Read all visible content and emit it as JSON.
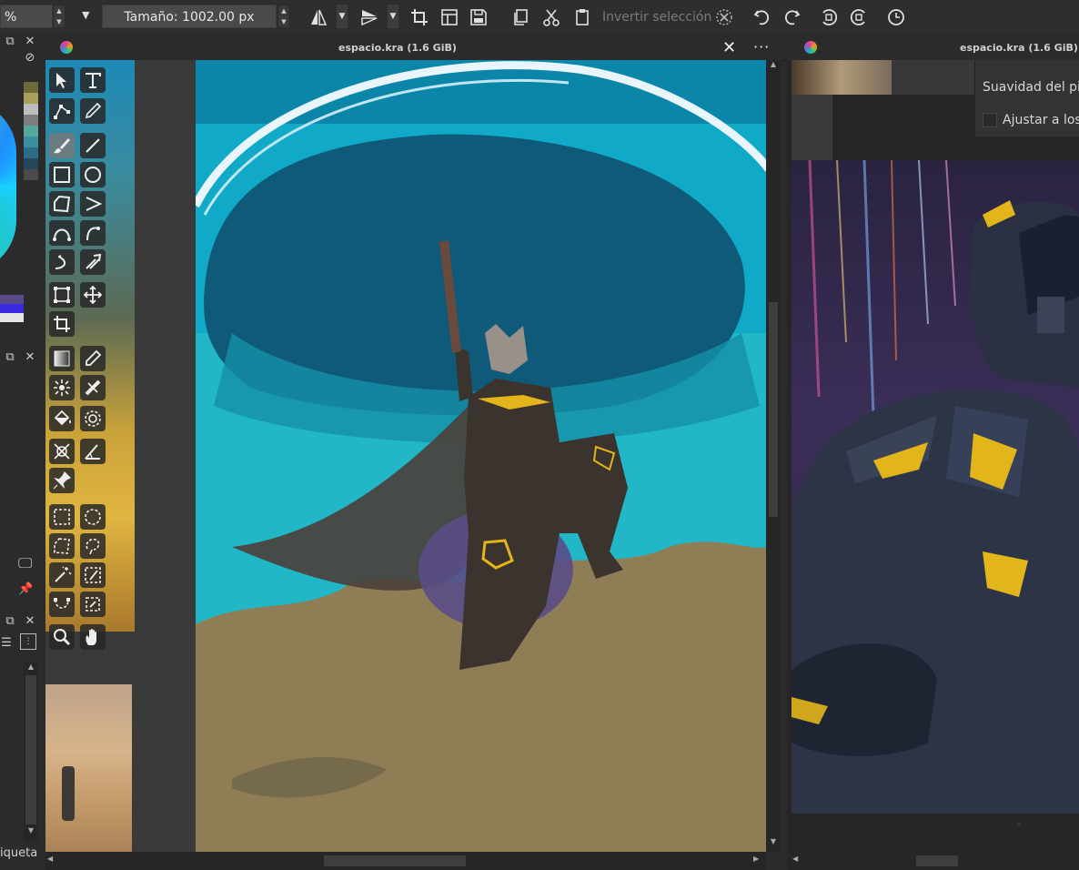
{
  "toolbar": {
    "opacity_value": "%",
    "size_value": "Tamaño: 1002.00 px",
    "invert_selection": "Invertir selección"
  },
  "view1": {
    "title": "espacio.kra (1.6 GiB)",
    "more": "···",
    "close": "✕"
  },
  "view2": {
    "title": "espacio.kra (1.6 GiB)"
  },
  "popup": {
    "smoothness_label": "Suavidad del pi",
    "snap_label": "Ajustar a los"
  },
  "leftdock": {
    "label_tag": "iqueta"
  },
  "colors": {
    "accent_cyan": "#1db5c9",
    "sand": "#8f7e55",
    "sky_dark": "#0e5a78",
    "armor_yellow": "#e2b51a"
  },
  "palette": [
    "#6f6a3a",
    "#a8a05a",
    "#bdbdbd",
    "#7d7d7d",
    "#57a89c",
    "#3a8fa0",
    "#2a6e86",
    "#24475a",
    "#4a4a4a"
  ],
  "tools": [
    "select-shapes",
    "text",
    "edit-shapes",
    "calligraphy",
    "freehand-brush",
    "line",
    "rectangle",
    "ellipse",
    "polygon",
    "polyline",
    "bezier",
    "freehand-path",
    "dynamic-brush",
    "multibrush",
    "transform",
    "move",
    "crop",
    "gradient",
    "color-picker",
    "colorize-mask",
    "smart-patch",
    "fill",
    "enclose-fill",
    "assistant",
    "measure",
    "reference-images",
    "rect-select",
    "ellipse-select",
    "polygon-select",
    "freehand-select",
    "contiguous-select",
    "similar-select",
    "bezier-select",
    "magnetic-select",
    "zoom",
    "pan"
  ]
}
